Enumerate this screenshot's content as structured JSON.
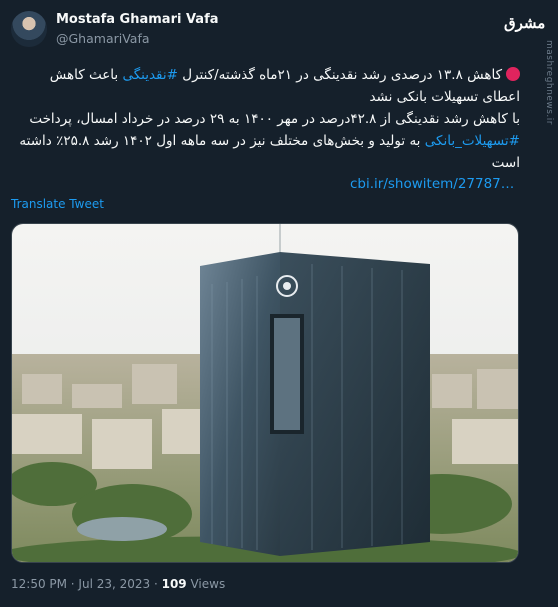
{
  "author": {
    "name": "Mostafa Ghamari Vafa",
    "handle": "@GhamariVafa"
  },
  "brand": {
    "logo_text": "مشرق",
    "watermark": "mashreghnews.ir"
  },
  "tweet": {
    "line1_a": "کاهش ۱۳.۸ درصدی رشد نقدینگی در ۲۱ماه گذشته/کنترل ",
    "line1_tag": "#نقدینگی",
    "line1_b": " باعث کاهش اعطای تسهیلات بانکی نشد",
    "line2": "با کاهش رشد نقدینگی از ۴۲.۸درصد در مهر ۱۴۰۰ به ۲۹ درصد در خرداد امسال، پرداخت",
    "line3_tag": "#تسهیلات_بانکی",
    "line3_b": " به تولید و بخش‌های مختلف نیز در سه ماهه اول ۱۴۰۲ رشد ۲۵.۸٪ داشته است",
    "link": "cbi.ir/showitem/27787…",
    "translate_label": "Translate Tweet"
  },
  "meta": {
    "time": "12:50 PM · Jul 23, 2023 · ",
    "views_count": "109",
    "views_label": " Views"
  },
  "colors": {
    "background": "#15202b",
    "link": "#1d9bf0",
    "secondary": "#8b98a5",
    "red_dot": "#e0245e"
  }
}
